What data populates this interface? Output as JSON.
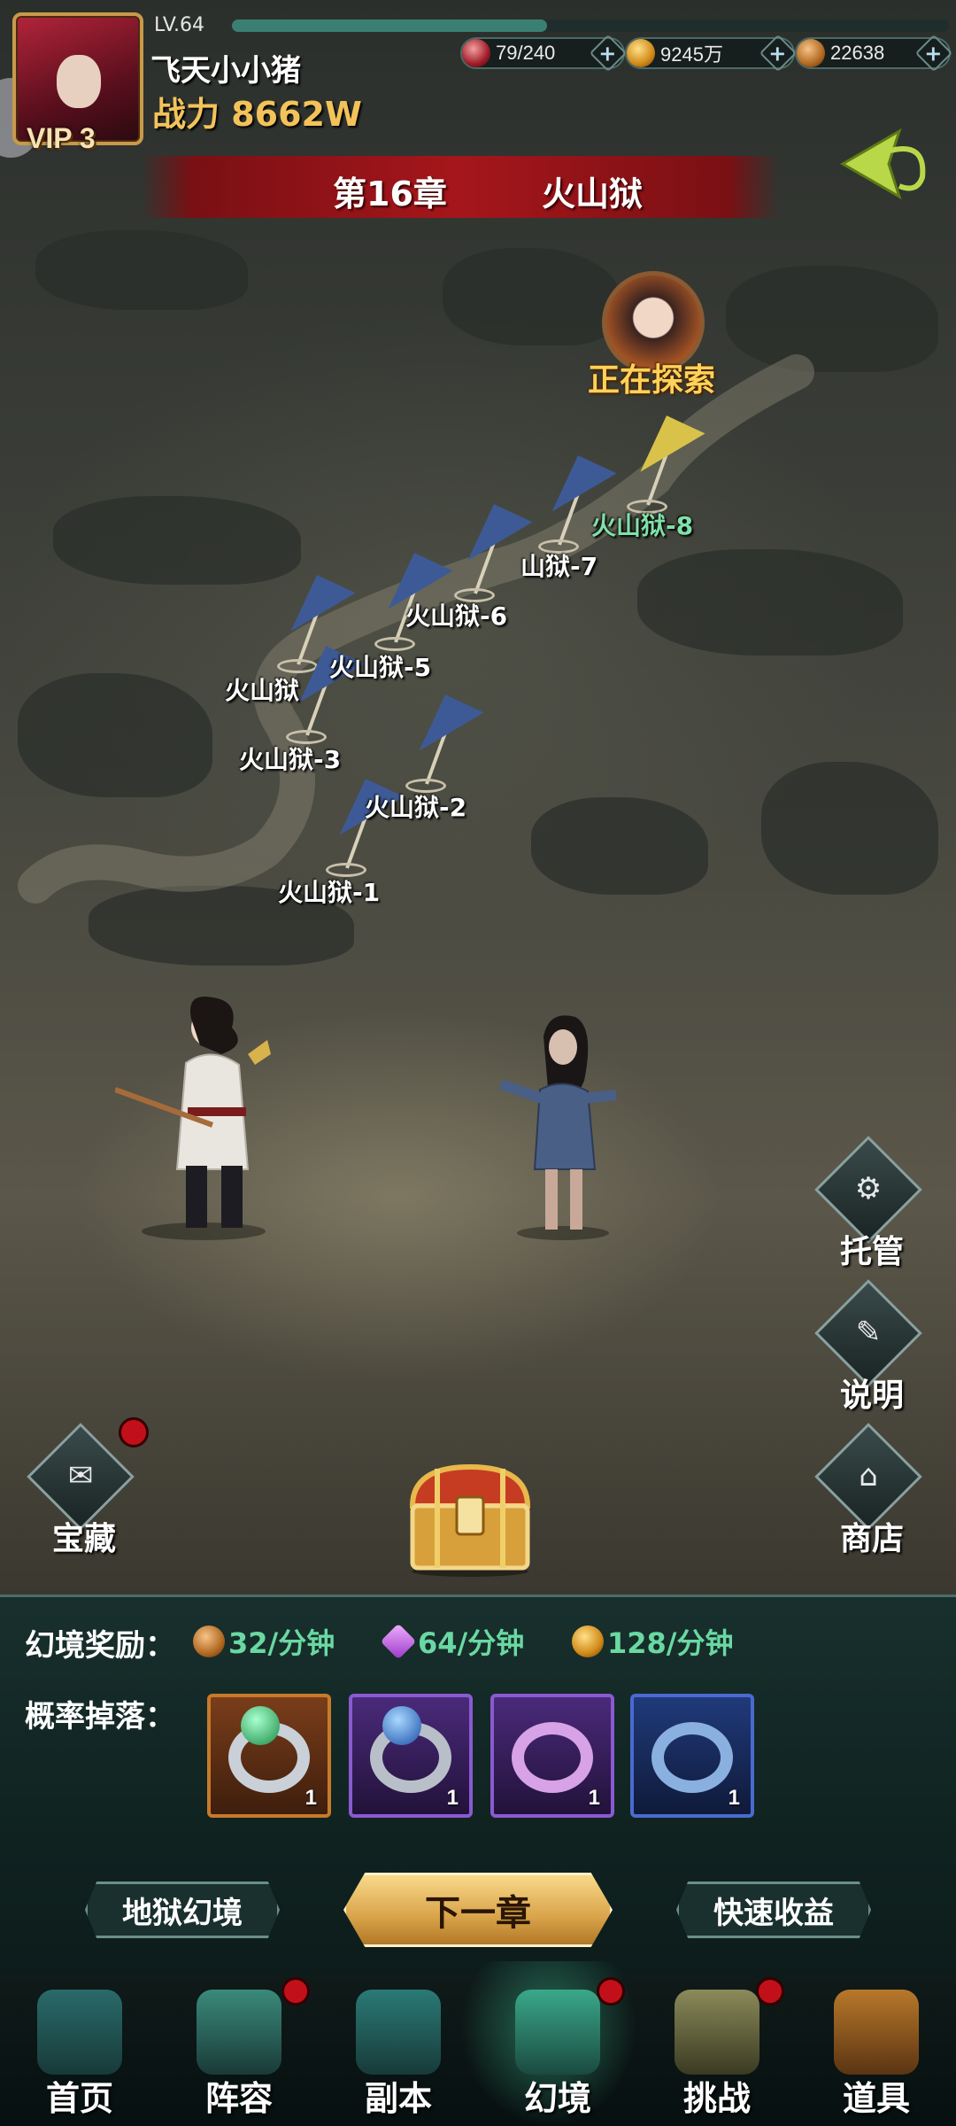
{
  "player": {
    "level": "LV.64",
    "vip": "VIP 3",
    "name": "飞天小小猪",
    "power": "战力 8662W",
    "xp_fraction": 0.44
  },
  "resources": [
    {
      "icon": "stamina-icon",
      "value": "79/240"
    },
    {
      "icon": "gold-coin-icon",
      "value": "9245万"
    },
    {
      "icon": "copper-coin-icon",
      "value": "22638"
    }
  ],
  "chapter": {
    "number": "第16章",
    "name": "火山狱"
  },
  "map": {
    "exploring": "正在探索",
    "stages": [
      {
        "label": "火山狱-1"
      },
      {
        "label": "火山狱-2"
      },
      {
        "label": "火山狱-3"
      },
      {
        "label": "火山狱"
      },
      {
        "label": "火山狱-5"
      },
      {
        "label": "火山狱-6"
      },
      {
        "label": "山狱-7"
      },
      {
        "label": "火山狱-8"
      }
    ]
  },
  "side_buttons": {
    "auto": "托管",
    "info": "说明",
    "shop": "商店",
    "treasure": "宝藏"
  },
  "rewards": {
    "label": "幻境奖励：",
    "rates": [
      "32/分钟",
      "64/分钟",
      "128/分钟"
    ],
    "drop_label": "概率掉落：",
    "items": [
      {
        "name": "jade-ring",
        "count": "1"
      },
      {
        "name": "sapphire-ring",
        "count": "1"
      },
      {
        "name": "purple-band",
        "count": "1"
      },
      {
        "name": "blue-band",
        "count": "1"
      }
    ]
  },
  "actions": {
    "left": "地狱幻境",
    "center": "下一章",
    "right": "快速收益"
  },
  "nav": [
    {
      "label": "首页",
      "dot": false
    },
    {
      "label": "阵容",
      "dot": true
    },
    {
      "label": "副本",
      "dot": false
    },
    {
      "label": "幻境",
      "dot": true,
      "active": true
    },
    {
      "label": "挑战",
      "dot": true
    },
    {
      "label": "道具",
      "dot": false
    }
  ],
  "colors": {
    "accent_gold": "#f3c35a",
    "rate_green": "#6ad8a2",
    "banner_red": "#a5161b",
    "badge_red": "#c2101a"
  }
}
